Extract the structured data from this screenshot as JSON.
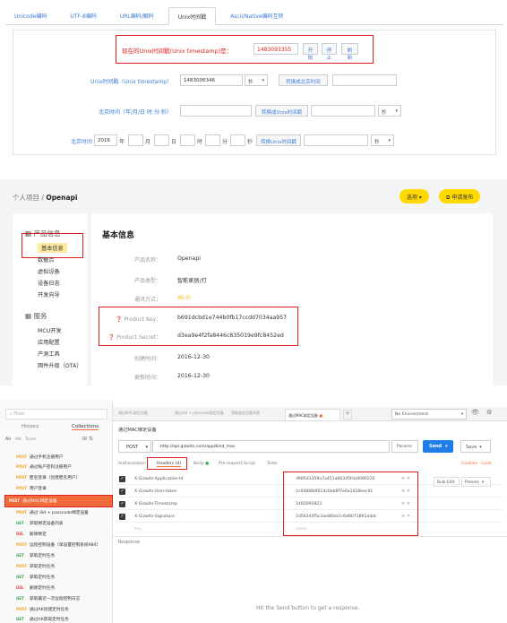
{
  "panel1": {
    "tabs": [
      "Unicode编码",
      "UTF-8编码",
      "URL编码/解码",
      "Unix时间戳",
      "Ascii/Native编码互转"
    ],
    "active_tab": "Unix时间戳",
    "current_label": "现在的Unix时间戳(Unix timestamp)是：",
    "current_value": "1483093355",
    "btn_start": "开始",
    "btn_stop": "停止",
    "btn_refresh": "刷新",
    "row1_label": "Unix时间戳（Unix timestamp）",
    "row1_value": "1483006346",
    "row1_unit": "秒",
    "row1_button": "转换成北京时间",
    "row2_label": "北京时间（年/月/日 时:分:秒）",
    "row2_button": "转换成Unix时间戳",
    "row2_unit": "秒",
    "row3_label": "北京时间",
    "row3_year": "2016",
    "units": [
      "年",
      "月",
      "日",
      "时",
      "分",
      "秒"
    ],
    "row3_button": "转换Unix时间戳",
    "row3_unit": "秒"
  },
  "panel2": {
    "breadcrumb_root": "个人项目",
    "breadcrumb_sep": "/",
    "breadcrumb_current": "Openapi",
    "btn_options": "选项 ▾",
    "btn_publish": "申请发布",
    "side_section1": "产品信息",
    "side_items1": [
      "基本信息",
      "数据点",
      "虚拟设备",
      "设备日志",
      "开发向导"
    ],
    "side_section2": "服务",
    "side_items2": [
      "MCU开发",
      "应用配置",
      "产测工具",
      "固件升级（OTA）"
    ],
    "title": "基本信息",
    "fields": [
      {
        "label": "产品名称：",
        "value": "Openapi"
      },
      {
        "label": "产品类型：",
        "value": "智能家居/灯"
      },
      {
        "label": "通讯方式：",
        "value": "Wi-Fi"
      },
      {
        "label": "Product Key：",
        "value": "b691dcbd1e744b0fb17ccdd7034aa957"
      },
      {
        "label": "Product Secret：",
        "value": "d3ea9e4f2fa8446c835019e9fc8452ed"
      },
      {
        "label": "创建时间：",
        "value": "2016-12-30"
      },
      {
        "label": "更新时间：",
        "value": "2016-12-30"
      }
    ]
  },
  "panel3": {
    "filter_placeholder": "Filter",
    "tab_history": "History",
    "tab_collections": "Collections",
    "filters": [
      "All",
      "Me",
      "Team"
    ],
    "requests": [
      {
        "method": "POST",
        "name": "通过手机注册用户"
      },
      {
        "method": "POST",
        "name": "通过账户密码注册用户"
      },
      {
        "method": "POST",
        "name": "匿名登录（创建匿名用户）"
      },
      {
        "method": "POST",
        "name": "用户登录"
      },
      {
        "method": "POST",
        "name": "通过MAC绑定设备"
      },
      {
        "method": "POST",
        "name": "通过 did + passcode绑定设备"
      },
      {
        "method": "GET",
        "name": "获取绑定设备列表"
      },
      {
        "method": "DEL",
        "name": "解除绑定"
      },
      {
        "method": "POST",
        "name": "远程控制设备（单设置控制系统984）"
      },
      {
        "method": "GET",
        "name": "获取定时任务"
      },
      {
        "method": "POST",
        "name": "获取定时任务"
      },
      {
        "method": "GET",
        "name": "获取定时任务"
      },
      {
        "method": "DEL",
        "name": "删除定时任务"
      },
      {
        "method": "GET",
        "name": "获取最近一次远程控制日志"
      },
      {
        "method": "POST",
        "name": "通过AK创建定时任务"
      },
      {
        "method": "GET",
        "name": "通过AK获取定时任务"
      }
    ],
    "top_tabs": [
      "通过MAC绑定设备",
      "通过did + passcode绑定设备",
      "获取绑定设备列表",
      "通过MAC绑定设备"
    ],
    "env": "No Environment",
    "collection_title": "通过MAC绑定设备",
    "method": "POST",
    "url": "http://api.gizwits.com/app/bind_mac",
    "btn_params": "Params",
    "btn_send": "Send",
    "btn_save": "Save",
    "req_tabs": [
      "Authorization",
      "Headers (4)",
      "Body",
      "Pre-request Script",
      "Tests"
    ],
    "cookies": "Cookies",
    "code": "Code",
    "bulk_edit": "Bulk Edit",
    "presets": "Presets",
    "headers": [
      {
        "key": "X-Gizwits-Application-Id",
        "value": "d985d1359a7a451a80345fcb9080220"
      },
      {
        "key": "X-Gizwits-User-token",
        "value": "2c04888df614c0eb8f7e6a1028eec91"
      },
      {
        "key": "X-Gizwits-Timestamp",
        "value": "1483092823"
      },
      {
        "key": "X-Gizwits-Signature",
        "value": "2d56344f5c3ae86da1c6d8071891d4dc"
      }
    ],
    "key_placeholder": "key",
    "value_placeholder": "value",
    "response_label": "Response",
    "hint": "Hit the Send button to get a response."
  },
  "colors": {
    "red": "#e02020",
    "yellow": "#ffd900",
    "postman_orange": "#f26b3a",
    "send_blue": "#1e7de6"
  }
}
